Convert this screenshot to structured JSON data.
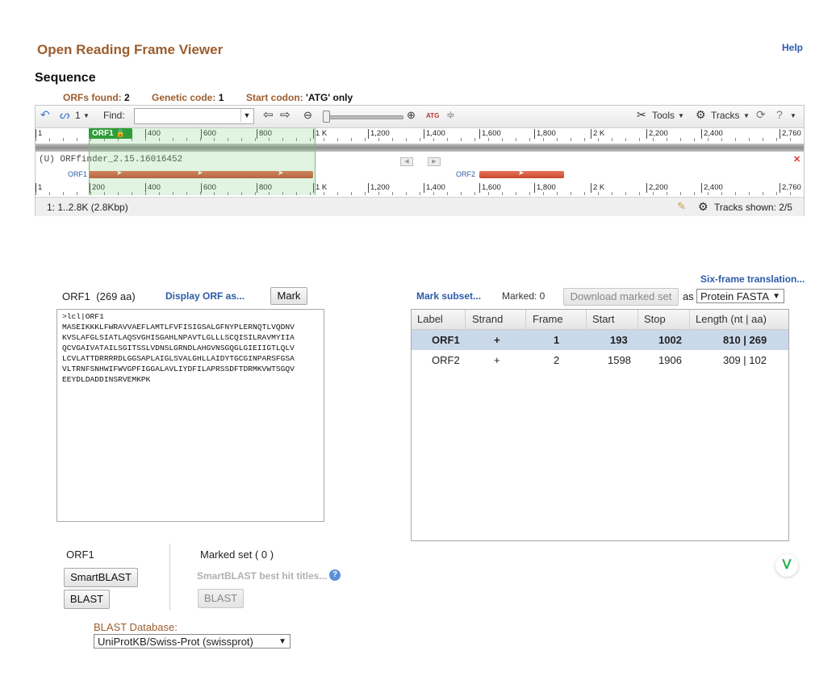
{
  "page": {
    "title": "Open Reading Frame Viewer",
    "help": "Help",
    "section": "Sequence"
  },
  "info": {
    "orfs_label": "ORFs found:",
    "orfs_value": "2",
    "code_label": "Genetic code:",
    "code_value": "1",
    "start_label": "Start codon:",
    "start_value": "'ATG' only"
  },
  "toolbar": {
    "track_count": "1",
    "find_label": "Find:",
    "tools_label": "Tools",
    "tracks_label": "Tracks",
    "atg_label": "ATG"
  },
  "ruler_top": [
    "1",
    "400",
    "600",
    "800",
    "1 K",
    "1,200",
    "1,400",
    "1,600",
    "1,800",
    "2 K",
    "2,200",
    "2,400",
    "2,760"
  ],
  "ruler_bottom": [
    "1",
    "200",
    "400",
    "600",
    "800",
    "1 K",
    "1,200",
    "1,400",
    "1,600",
    "1,800",
    "2 K",
    "2,200",
    "2,400",
    "2,760"
  ],
  "viewer": {
    "selected_tag": "ORF1",
    "track_name": "(U) ORFfinder_2.15.16016452",
    "orf1_label": "ORF1",
    "orf2_label": "ORF2",
    "range_text": "1: 1..2.8K (2.8Kbp)",
    "tracks_shown": "Tracks shown: 2/5"
  },
  "orf_panel": {
    "name": "ORF1",
    "aa": "(269 aa)",
    "display_as": "Display ORF as...",
    "mark_button": "Mark",
    "fasta": ">lcl|ORF1\nMASEIKKKLFWRAVVAEFLAMTLFVFISIGSALGFNYPLERNQTLVQDNV\nKVSLAFGLSIATLAQSVGHISGAHLNPAVTLGLLLSCQISILRAVMYIIA\nQCVGAIVATAILSGITSSLVDNSLGRNDLAHGVNSGQGLGIEIIGTLQLV\nLCVLATTDRRRRDLGGSAPLAIGLSVALGHLLAIDYTGCGINPARSFGSA\nVLTRNFSNHWIFWVGPFIGGALAVLIYDFILAPRSSDFTDRMKVWTSGQV\nEEYDLDADDINSRVEMKPK"
  },
  "table_panel": {
    "six_frame": "Six-frame translation...",
    "mark_subset": "Mark subset...",
    "marked": "Marked: 0",
    "download_button": "Download marked set",
    "as_label": "as",
    "format_value": "Protein FASTA",
    "headers": [
      "Label",
      "Strand",
      "Frame",
      "Start",
      "Stop",
      "Length (nt | aa)"
    ],
    "rows": [
      {
        "label": "ORF1",
        "strand": "+",
        "frame": "1",
        "start": "193",
        "stop": "1002",
        "length": "810 | 269"
      },
      {
        "label": "ORF2",
        "strand": "+",
        "frame": "2",
        "start": "1598",
        "stop": "1906",
        "length": "309 | 102"
      }
    ]
  },
  "blast": {
    "orf_title": "ORF1",
    "smartblast_button": "SmartBLAST",
    "blast_button": "BLAST",
    "marked_set_label": "Marked set",
    "marked_set_count": "( 0 )",
    "smart_titles": "SmartBLAST best hit titles...",
    "marked_blast_button": "BLAST",
    "db_label": "BLAST Database:",
    "db_value": "UniProtKB/Swiss-Prot (swissprot)"
  },
  "icons": [
    "undo-icon",
    "tracks-icon",
    "back-arrow-icon",
    "forward-arrow-icon",
    "zoom-out-icon",
    "zoom-in-icon",
    "atg-icon",
    "collapse-icon",
    "tools-icon",
    "gear-icon",
    "refresh-icon",
    "question-icon",
    "pencil-icon",
    "close-icon",
    "lock-icon"
  ]
}
